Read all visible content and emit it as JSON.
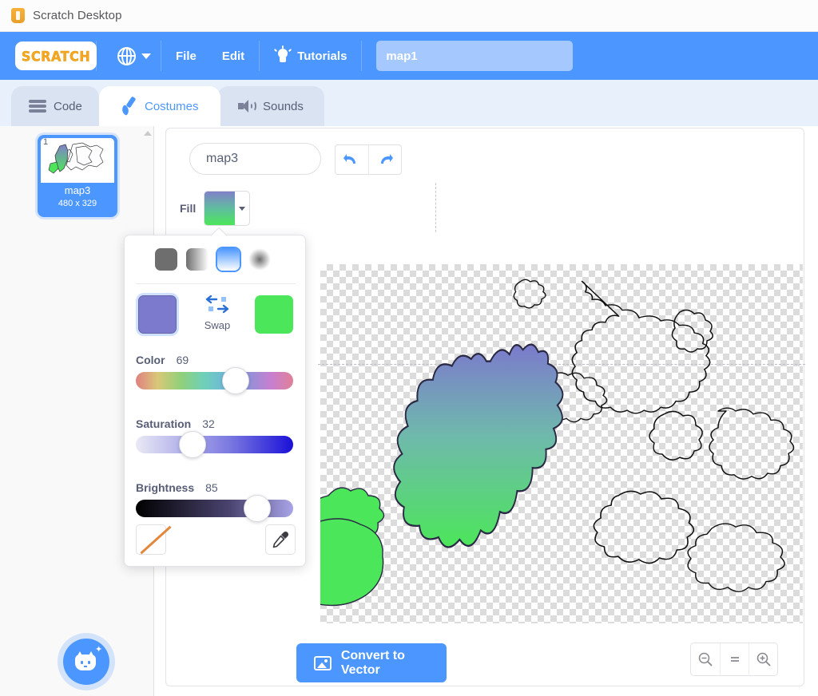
{
  "window": {
    "title": "Scratch Desktop",
    "app_icon": "scratch-shield-icon"
  },
  "menubar": {
    "globe_icon": "globe-icon",
    "caret_icon": "chevron-down-icon",
    "file_label": "File",
    "edit_label": "Edit",
    "tutorials_icon": "lightbulb-icon",
    "tutorials_label": "Tutorials",
    "logo_text": "SCRATCH",
    "project_name": "map1"
  },
  "tabs": [
    {
      "label": "Code",
      "icon": "blocks-icon",
      "selected": false
    },
    {
      "label": "Costumes",
      "icon": "paintbrush-icon",
      "selected": true
    },
    {
      "label": "Sounds",
      "icon": "speaker-icon",
      "selected": false
    }
  ],
  "costume_list": {
    "items": [
      {
        "number": "1",
        "name": "map3",
        "size": "480 x 329",
        "selected": true
      }
    ],
    "add_button_icon": "cat-face-icon"
  },
  "paint_editor": {
    "costume_name": "map3",
    "undo_icon": "undo-arrow-icon",
    "redo_icon": "redo-arrow-icon",
    "fill_label": "Fill",
    "fill_caret_icon": "chevron-down-icon",
    "fill_gradient_start": "#8080c9",
    "fill_gradient_end": "#4ce65a",
    "convert_button_label": "Convert to Vector",
    "convert_button_icon": "image-icon",
    "zoom_out_icon": "zoom-out-icon",
    "zoom_reset_icon": "zoom-reset-icon",
    "zoom_in_icon": "zoom-in-icon"
  },
  "color_picker": {
    "gradient_types": [
      {
        "name": "solid",
        "selected": false
      },
      {
        "name": "horizontal",
        "selected": false
      },
      {
        "name": "vertical",
        "selected": true
      },
      {
        "name": "radial",
        "selected": false
      }
    ],
    "swatch_primary": "#7b7acc",
    "swatch_secondary": "#4ce65a",
    "swap_label": "Swap",
    "sliders": [
      {
        "label": "Color",
        "value": "69",
        "percent": 66
      },
      {
        "label": "Saturation",
        "value": "32",
        "percent": 33
      },
      {
        "label": "Brightness",
        "value": "85",
        "percent": 83
      }
    ],
    "no_color_icon": "no-color-icon",
    "eyedropper_icon": "eyedropper-icon"
  }
}
